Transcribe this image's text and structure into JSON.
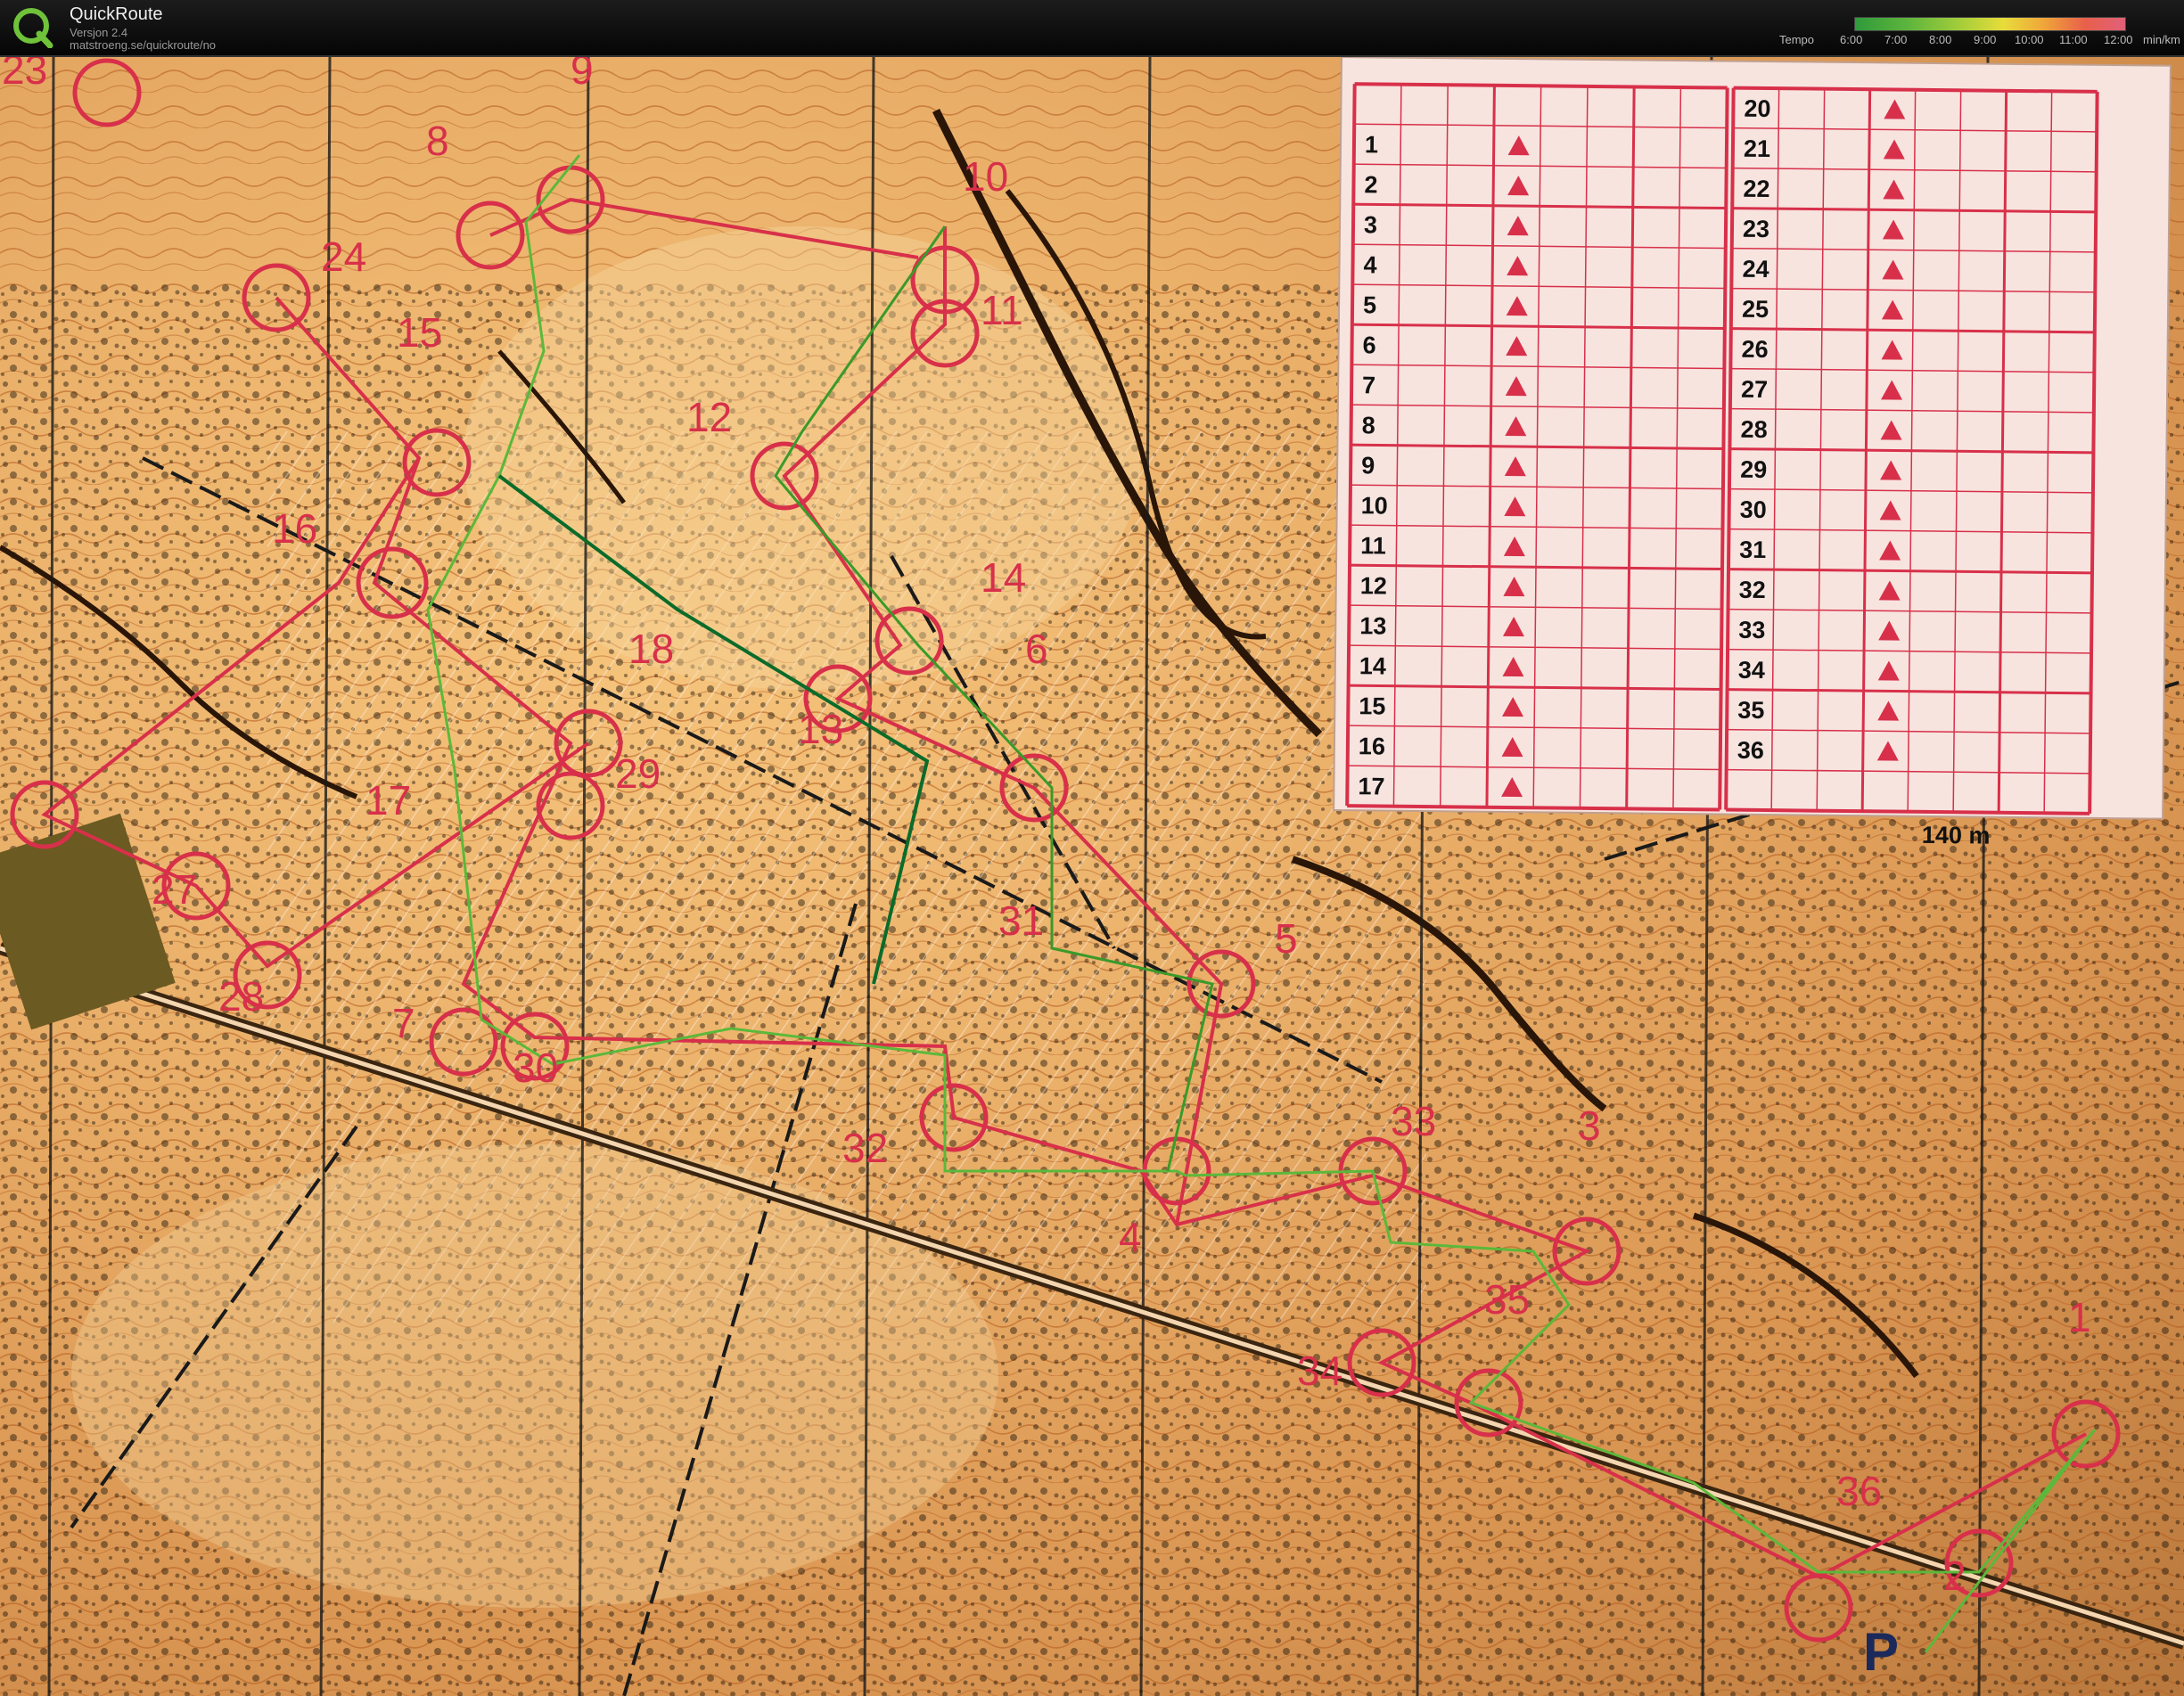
{
  "app": {
    "title": "QuickRoute",
    "version": "Versjon 2.4",
    "url": "matstroeng.se/quickroute/no"
  },
  "tempo_legend": {
    "label": "Tempo",
    "ticks": [
      "6:00",
      "7:00",
      "8:00",
      "9:00",
      "10:00",
      "11:00",
      "12:00"
    ],
    "unit": "min/km"
  },
  "map": {
    "control_numbers": [
      "23",
      "24",
      "15",
      "16",
      "18",
      "17",
      "27",
      "28",
      "29",
      "7",
      "30",
      "8",
      "9",
      "10",
      "11",
      "12",
      "14",
      "13",
      "6",
      "31",
      "5",
      "32",
      "4",
      "33",
      "3",
      "35",
      "34",
      "1",
      "36",
      "2",
      "P"
    ],
    "description_sheet": {
      "left_column_numbers": [
        "1",
        "2",
        "3",
        "4",
        "5",
        "6",
        "7",
        "8",
        "9",
        "10",
        "11",
        "12",
        "13",
        "14",
        "15",
        "16",
        "17"
      ],
      "right_column_numbers": [
        "20",
        "21",
        "22",
        "23",
        "24",
        "25",
        "26",
        "27",
        "28",
        "29",
        "30",
        "31",
        "32",
        "33",
        "34",
        "35",
        "36"
      ],
      "finish_distance": "140 m"
    }
  },
  "colors": {
    "course_red": "#d8304a",
    "route_green": "#3a9a2a",
    "route_dark_green": "#0b6b2a",
    "map_base": "#eab06a"
  },
  "icons": {
    "logo": "quickroute-q-logo"
  }
}
